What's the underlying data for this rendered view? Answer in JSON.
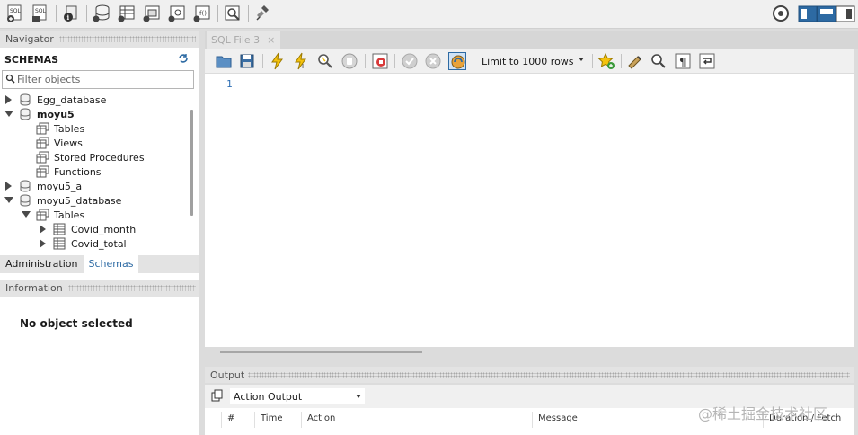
{
  "colors": {
    "accent": "#2d6aa3",
    "line_number": "#2f6fb5",
    "background": "#dcdcdc"
  },
  "top_toolbar": {
    "icons": [
      "new-sql-tab-icon",
      "open-sql-script-icon",
      "info-icon",
      "create-schema-icon",
      "create-table-icon",
      "create-view-icon",
      "create-procedure-icon",
      "create-function-icon",
      "search-table-data-icon",
      "reconnect-icon",
      "settings-icon",
      "layout-toggle-icon"
    ]
  },
  "navigator": {
    "header": "Navigator",
    "schemas_label": "SCHEMAS",
    "filter_placeholder": "Filter objects",
    "tree": [
      {
        "label": "Egg_database",
        "level": 0,
        "expanded": false,
        "kind": "schema",
        "bold": false
      },
      {
        "label": "moyu5",
        "level": 0,
        "expanded": true,
        "kind": "schema",
        "bold": true
      },
      {
        "label": "Tables",
        "level": 1,
        "kind": "folder"
      },
      {
        "label": "Views",
        "level": 1,
        "kind": "folder"
      },
      {
        "label": "Stored Procedures",
        "level": 1,
        "kind": "folder"
      },
      {
        "label": "Functions",
        "level": 1,
        "kind": "folder"
      },
      {
        "label": "moyu5_a",
        "level": 0,
        "expanded": false,
        "kind": "schema",
        "bold": false
      },
      {
        "label": "moyu5_database",
        "level": 0,
        "expanded": true,
        "kind": "schema",
        "bold": false
      },
      {
        "label": "Tables",
        "level": 1,
        "expanded": true,
        "kind": "folder"
      },
      {
        "label": "Covid_month",
        "level": 2,
        "expanded": false,
        "kind": "table"
      },
      {
        "label": "Covid_total",
        "level": 2,
        "expanded": false,
        "kind": "table"
      }
    ],
    "tabs": [
      "Administration",
      "Schemas"
    ],
    "active_tab": "Schemas"
  },
  "information": {
    "header": "Information",
    "empty_text": "No object selected"
  },
  "editor": {
    "tab_label": "SQL File 3",
    "tab_close": "×",
    "limit_select": "Limit to 1000 rows",
    "line_numbers": [
      "1"
    ]
  },
  "output": {
    "header": "Output",
    "select_value": "Action Output",
    "columns": [
      "#",
      "Time",
      "Action",
      "Message",
      "Duration / Fetch"
    ]
  },
  "watermark": "@稀土掘金技术社区"
}
